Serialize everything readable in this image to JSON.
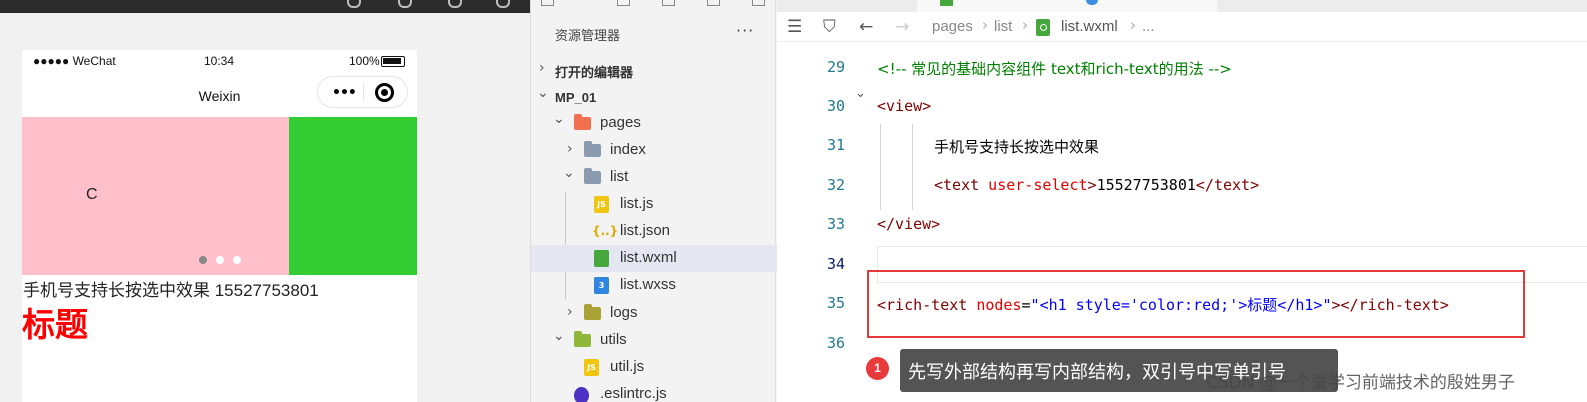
{
  "simulator": {
    "status_carrier": "●●●●● WeChat",
    "status_time": "10:34",
    "status_battery": "100%",
    "nav_title": "Weixin",
    "capsule_more": "•••",
    "swiper": {
      "slide_label": "C",
      "slide_colors": [
        "#ffc0cb",
        "#33cc33"
      ],
      "indicator_count": 3,
      "active_indicator": 1
    },
    "text_line": "手机号支持长按选中效果 15527753801",
    "rich_text_heading": "标题",
    "heading_color": "#ff0000"
  },
  "explorer": {
    "title": "资源管理器",
    "more": "···",
    "items": [
      {
        "label": "打开的编辑器",
        "chevron": "›"
      },
      {
        "label": "MP_01",
        "chevron": "⌄"
      },
      {
        "label": "pages",
        "chevron": "⌄"
      },
      {
        "label": "index",
        "chevron": "›"
      },
      {
        "label": "list",
        "chevron": "⌄"
      },
      {
        "label": "list.js",
        "icon": "JS"
      },
      {
        "label": "list.json",
        "icon": "{..}"
      },
      {
        "label": "list.wxml",
        "icon": "wxml"
      },
      {
        "label": "list.wxss",
        "icon": "3"
      },
      {
        "label": "logs",
        "chevron": "›"
      },
      {
        "label": "utils",
        "chevron": "⌄"
      },
      {
        "label": "util.js",
        "icon": "JS"
      },
      {
        "label": ".eslintrc.js"
      }
    ]
  },
  "editor": {
    "breadcrumb": [
      "pages",
      "list",
      "list.wxml",
      "..."
    ],
    "lines": [
      {
        "no": "29"
      },
      {
        "no": "30"
      },
      {
        "no": "31"
      },
      {
        "no": "32"
      },
      {
        "no": "33"
      },
      {
        "no": "34"
      },
      {
        "no": "35"
      },
      {
        "no": "36"
      }
    ],
    "code": {
      "l29": "<!-- 常见的基础内容组件 text和rich-text的用法 -->",
      "l30_open": "<",
      "l30_tag": "view",
      "l30_close": ">",
      "l31": "手机号支持长按选中效果",
      "l32_open": "<",
      "l32_tag": "text",
      "l32_attr": " user-select",
      "l32_gt": ">",
      "l32_content": "15527753801",
      "l32_end": "</text>",
      "l33": "</view>",
      "l35_open": "<",
      "l35_tag": "rich-text",
      "l35_attr": " nodes",
      "l35_eq": "=",
      "l35_q1": "\"",
      "l35_h1_open": "<h1 style='color:red;'>",
      "l35_h1_text": "标题",
      "l35_h1_close": "</h1>",
      "l35_q2": "\"",
      "l35_end": "></rich-text>"
    },
    "annotation_number": "1",
    "annotation_text": "先写外部结构再写内部结构，双引号中写单引号",
    "watermark": "CSDN @一个爱学习前端技术的殷姓男子",
    "highlight_color": "#e53a36"
  }
}
